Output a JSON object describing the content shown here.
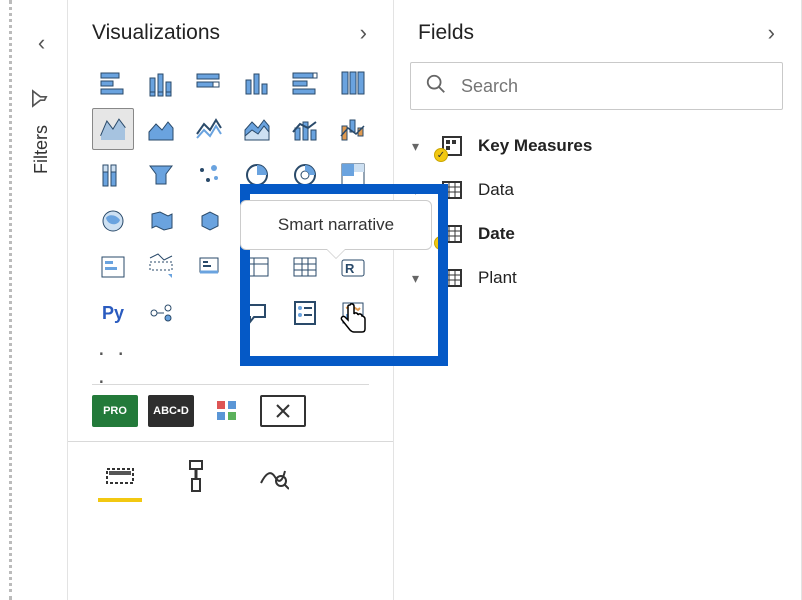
{
  "filters": {
    "label": "Filters"
  },
  "visualizations": {
    "title": "Visualizations",
    "tooltip": "Smart narrative",
    "icons": [
      "stacked-bar",
      "clustered-bar",
      "stacked-column",
      "clustered-column",
      "stacked-column-100",
      "line-chart",
      "area-chart",
      "stacked-area",
      "line-clustered",
      "line-stacked",
      "ribbon-chart",
      "waterfall",
      "funnel",
      "scatter",
      "pie-chart",
      "donut-chart",
      "treemap",
      "map",
      "filled-map",
      "shape-map",
      "gauge",
      "card",
      "multi-card",
      "kpi",
      "slicer",
      "table",
      "matrix",
      "r-visual",
      "python",
      "key-influencers",
      "q-and-a",
      "q-and-a2",
      "decomposition",
      "smart-narrative",
      "paginated"
    ],
    "selected": "area-chart",
    "python_label": "Py",
    "extras": {
      "pro": "PRO",
      "abc": "ABC▪D"
    }
  },
  "fields": {
    "title": "Fields",
    "search_placeholder": "Search",
    "items": [
      {
        "name": "Key Measures",
        "icon": "measures",
        "bold": true,
        "badge": true
      },
      {
        "name": "Data",
        "icon": "table",
        "bold": false,
        "badge": false
      },
      {
        "name": "Date",
        "icon": "table",
        "bold": true,
        "badge": true
      },
      {
        "name": "Plant",
        "icon": "table",
        "bold": false,
        "badge": false
      }
    ]
  }
}
